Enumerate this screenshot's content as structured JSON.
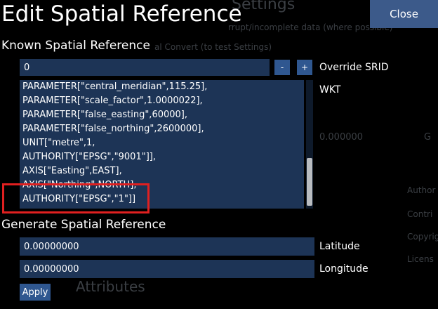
{
  "window": {
    "title": "Edit Spatial Reference",
    "close_label": "Close"
  },
  "background": {
    "heading_fragment": "Settings",
    "line1": "rrupt/incomplete data (where possible)",
    "line2": "al Convert (to test Settings)",
    "value1": "0.000000",
    "value2": "G",
    "side1": "Author",
    "side2": "Contri",
    "side3": "Copyrig",
    "side4": "Licens",
    "attributes": "Attributes"
  },
  "known": {
    "section_label": "Known Spatial Reference",
    "srid_value": "0",
    "minus_label": "-",
    "plus_label": "+",
    "override_label": "Override SRID",
    "wkt_label": "WKT",
    "wkt_lines": [
      "PARAMETER[\"central_meridian\",115.25],",
      "PARAMETER[\"scale_factor\",1.0000022],",
      "PARAMETER[\"false_easting\",60000],",
      "PARAMETER[\"false_northing\",2600000],",
      "UNIT[\"metre\",1,",
      "AUTHORITY[\"EPSG\",\"9001\"]],",
      "AXIS[\"Easting\",EAST],",
      "AXIS[\"Northing\",NORTH],",
      "AUTHORITY[\"EPSG\",\"1\"]]"
    ]
  },
  "generate": {
    "section_label": "Generate Spatial Reference",
    "latitude_value": "0.00000000",
    "latitude_label": "Latitude",
    "longitude_value": "0.00000000",
    "longitude_label": "Longitude",
    "apply_label": "Apply"
  },
  "colors": {
    "field_bg": "#1d3456",
    "button_bg": "#2f5790",
    "close_bg": "#3c5a8a",
    "highlight": "#e02020"
  }
}
